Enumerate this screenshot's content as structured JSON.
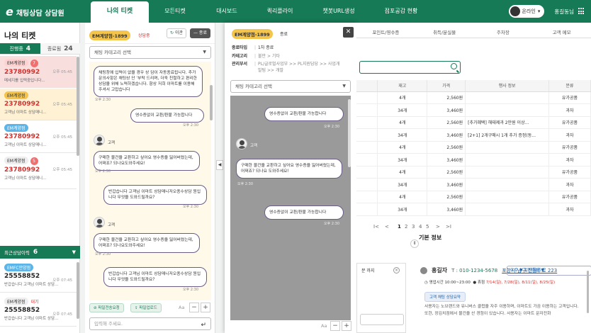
{
  "app": {
    "logo_glyph": "e",
    "title": "채팅상담 상담원",
    "nav": [
      "나의 티켓",
      "모든티켓",
      "대시보드",
      "퀵리플라이",
      "챗봇URL생성",
      "점포공감 현황"
    ],
    "status": "온라인",
    "user": "홍길동님"
  },
  "left": {
    "title": "나의 티켓",
    "tab_progress": "진행중",
    "tab_progress_count": "4",
    "tab_done": "종료됨",
    "tab_done_count": "24",
    "tickets": [
      {
        "tag": "EM계양점",
        "num": "23780992",
        "msg": "메세지를 입력중입니다...",
        "time": "오후 05:45",
        "badge": "7",
        "color": "#f7d9d9",
        "tagcolor": "#ffd9d9"
      },
      {
        "tag": "EM계양점",
        "num": "23780992",
        "msg": "고객님 이마트 상담매니...",
        "time": "오후 05:45",
        "badge": "",
        "color": "#fff3d6",
        "tagcolor": "#f4c44b"
      },
      {
        "tag": "EM계양점",
        "num": "23780992",
        "msg": "고객님 이마트 상담매니...",
        "time": "오후 05:45",
        "badge": "",
        "color": "#ffffff",
        "tagcolor": "#5bb5e8"
      },
      {
        "tag": "EM계양점",
        "num": "23780992",
        "msg": "고객님 이마트 상담매니...",
        "time": "오후 05:45",
        "badge": "5",
        "color": "#ffffff",
        "tagcolor": "#eeeeee"
      }
    ],
    "recent_title": "최근상담이력",
    "recent_count": "6",
    "recent": [
      {
        "tag": "EMFC안양점",
        "num": "25558852",
        "time": "오후 07:45",
        "msg": "반갑습니다 고객님 이마트 상담...",
        "tagcolor": "#5bb5e8",
        "extra": ""
      },
      {
        "tag": "EM계양점",
        "num": "25558852",
        "time": "오후 07:45",
        "msg": "반갑습니다 고객님 이마트 상담...",
        "tagcolor": "#eeeeee",
        "extra": "대기"
      }
    ]
  },
  "chat1": {
    "tag": "EM계양점-1899",
    "status": "상담중",
    "btn_transfer": "이관",
    "btn_end": "종료",
    "category_placeholder": "채팅 카테고리 선택",
    "messages": [
      {
        "side": "left",
        "text": "채팅창에 입력이 없을 경우 상 담이 자동종료됩니다. 추가 문의사항은 채팅상 단 '부탁 드리며, 더욱 친절하고 편리한 상담을 위해 노력하겠습니다. 항상 저희 이마트를 이용해주셔서 고맙습니다",
        "time": "오후 2:30"
      },
      {
        "side": "right",
        "text": "영수증없이 교환/환불 가능합니다",
        "time": "오후 2:30"
      },
      {
        "side": "customer",
        "name": "고객",
        "text": "구매한 물건을 교환하고 싶어요 영수증을 잃어버렸는데, 어쩌죠? 되나요도와주세요!",
        "time": "오후 2:30"
      },
      {
        "side": "right",
        "text": "반갑습니다 고객님 이마트 상담매니저오종수상담 원입니다 무엇을 도와드릴까요?",
        "time": "오후 2:30"
      },
      {
        "side": "customer",
        "name": "고객",
        "text": "구매한 물건을 교환하고 싶어요 영수증을 잃어버렸는데, 어쩌죠? 되나요도와주세요!",
        "time": "오후 2:30"
      },
      {
        "side": "right",
        "text": "반갑습니다 고객님 이마트 상담매니저오종수상담 원입니다 무엇을 도와드릴까요?",
        "time": "오후 2:30"
      }
    ],
    "btn_file_transfer": "파일전송요청",
    "btn_file_upload": "파일업로드",
    "font_label": "Aa",
    "minus": "−",
    "plus": "+",
    "input_placeholder": "입력해 주세요."
  },
  "popup": {
    "tag": "EM계양점-1899",
    "status": "종료",
    "end_type_label": "종료타입",
    "end_type": "1차 종료",
    "category_label": "카테고리",
    "category": "불만 > 기타",
    "dept_label": "관리부서",
    "dept": "PL/글로벌사업부 >> PL지원담당 >> 사업개발팀 >> 개발",
    "category_placeholder": "채팅 카테고리 선택",
    "messages": [
      {
        "side": "right",
        "text": "영수증없이 교환/환불 가능합니다",
        "time": "오후 2:30"
      },
      {
        "side": "customer",
        "name": "고객",
        "text": "구매한 물건을 교환하고 싶어요 영수증을 잃어버렸는데, 어쩌죠? 되나요 도와주세요!",
        "time": "오후 2:30"
      },
      {
        "side": "right",
        "text": "영수증없이 교환/환불 가능합니다",
        "time": "오후 2:30"
      }
    ],
    "font_label": "Aa",
    "minus": "−",
    "plus": "+"
  },
  "right": {
    "tabs": [
      "포인트/영수증",
      "취득/분실물",
      "주차장",
      "고객 메모"
    ],
    "table_headers": [
      "",
      "재고",
      "가격",
      "행사 정보",
      "분류"
    ],
    "rows": [
      [
        "",
        "4개",
        "2,560원",
        "",
        "유가공품"
      ],
      [
        "",
        "34개",
        "3,460원",
        "",
        "과자"
      ],
      [
        "",
        "4개",
        "2,560원",
        "[추가혜택] 해태제과 2만원 이상...",
        "유가공품"
      ],
      [
        "",
        "34개",
        "3,460원",
        "[2+1] 2개구매시 1개 추가 증정(동...",
        "과자"
      ],
      [
        "",
        "4개",
        "2,560원",
        "",
        "유가공품"
      ],
      [
        "",
        "34개",
        "3,460원",
        "",
        "과자"
      ],
      [
        "",
        "4개",
        "2,560원",
        "",
        "유가공품"
      ],
      [
        "",
        "34개",
        "3,460원",
        "",
        "과자"
      ],
      [
        "",
        "4개",
        "2,560원",
        "",
        "유가공품"
      ],
      [
        "",
        "34개",
        "3,460원",
        "",
        "과자"
      ]
    ],
    "pager": [
      "I<",
      "<",
      "1",
      "2",
      "3",
      "4",
      "5",
      ">",
      ">I"
    ],
    "basic_info": "기본 정보",
    "memo_text": "분 까지",
    "memo_close": "×",
    "customer_name": "홍길자",
    "customer_tel": "T : 010-1234-5678",
    "customer_addr": "포항시 남구 전몰주로 223",
    "grade": "우수 ▼ 일반회원 ▼",
    "hours": "영업시간 10:00~23:00",
    "closed_label": "휴점",
    "closed_dates": "7/14(일), 7/28(일), 8/11(일), 8/25(일)",
    "summary_pill": "고객 채팅 상담요약",
    "summary": "사용자는 노브랜드와 유니버스 클럽을 자주 이용하며, 이마트도 가끔 이용하는 고객입니다. 또한, 장김치점에서 물건을 산 경험이 있습니다. 사용자는 이마트 문자전화"
  }
}
